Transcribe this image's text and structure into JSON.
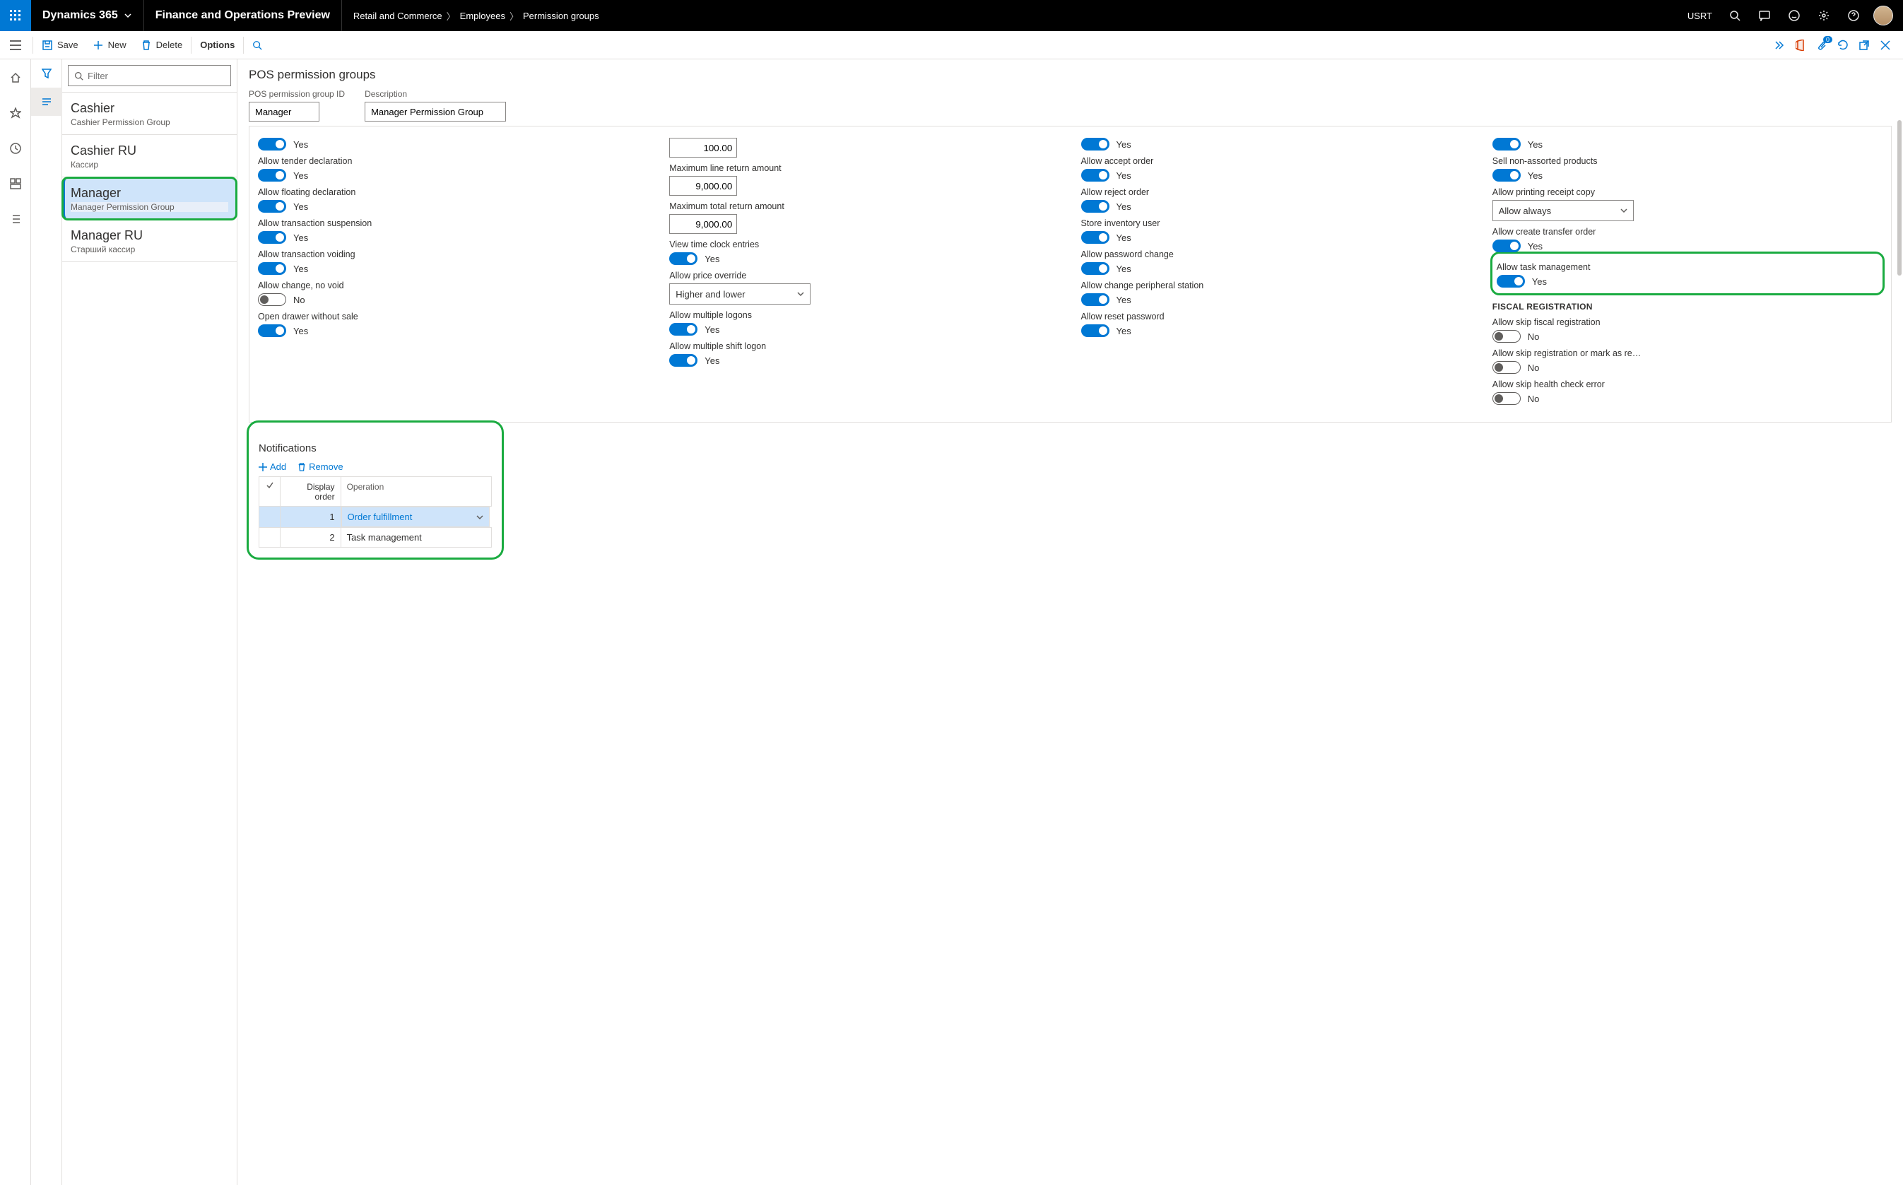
{
  "top": {
    "app": "Dynamics 365",
    "module": "Finance and Operations Preview",
    "crumbs": [
      "Retail and Commerce",
      "Employees",
      "Permission groups"
    ],
    "org": "USRT"
  },
  "toolbar": {
    "save": "Save",
    "new": "New",
    "delete": "Delete",
    "options": "Options",
    "badge": "0"
  },
  "filter_placeholder": "Filter",
  "list": [
    {
      "title": "Cashier",
      "sub": "Cashier Permission Group"
    },
    {
      "title": "Cashier RU",
      "sub": "Кассир"
    },
    {
      "title": "Manager",
      "sub": "Manager Permission Group"
    },
    {
      "title": "Manager RU",
      "sub": "Старший кассир"
    }
  ],
  "page": {
    "title": "POS permission groups",
    "id_label": "POS permission group ID",
    "id_value": "Manager",
    "desc_label": "Description",
    "desc_value": "Manager Permission Group"
  },
  "col1": [
    {
      "label": "",
      "val": "Yes",
      "on": true
    },
    {
      "label": "Allow tender declaration",
      "val": "Yes",
      "on": true
    },
    {
      "label": "Allow floating declaration",
      "val": "Yes",
      "on": true
    },
    {
      "label": "Allow transaction suspension",
      "val": "Yes",
      "on": true
    },
    {
      "label": "Allow transaction voiding",
      "val": "Yes",
      "on": true
    },
    {
      "label": "Allow change, no void",
      "val": "No",
      "on": false
    },
    {
      "label": "Open drawer without sale",
      "val": "Yes",
      "on": true
    }
  ],
  "col2_nums": [
    {
      "label": "",
      "val": "100.00"
    },
    {
      "label": "Maximum line return amount",
      "val": "9,000.00"
    },
    {
      "label": "Maximum total return amount",
      "val": "9,000.00"
    }
  ],
  "col2_tog": [
    {
      "label": "View time clock entries",
      "val": "Yes",
      "on": true
    }
  ],
  "col2_sel": {
    "label": "Allow price override",
    "val": "Higher and lower"
  },
  "col2_tog2": [
    {
      "label": "Allow multiple logons",
      "val": "Yes",
      "on": true
    },
    {
      "label": "Allow multiple shift logon",
      "val": "Yes",
      "on": true
    }
  ],
  "col3": [
    {
      "label": "",
      "val": "Yes",
      "on": true
    },
    {
      "label": "Allow accept order",
      "val": "Yes",
      "on": true
    },
    {
      "label": "Allow reject order",
      "val": "Yes",
      "on": true
    },
    {
      "label": "Store inventory user",
      "val": "Yes",
      "on": true
    },
    {
      "label": "Allow password change",
      "val": "Yes",
      "on": true
    },
    {
      "label": "Allow change peripheral station",
      "val": "Yes",
      "on": true
    },
    {
      "label": "Allow reset password",
      "val": "Yes",
      "on": true
    }
  ],
  "col4": [
    {
      "label": "",
      "val": "Yes",
      "on": true
    },
    {
      "label": "Sell non-assorted products",
      "val": "Yes",
      "on": true
    }
  ],
  "col4_sel": {
    "label": "Allow printing receipt copy",
    "val": "Allow always"
  },
  "col4b": [
    {
      "label": "Allow create transfer order",
      "val": "Yes",
      "on": true
    },
    {
      "label": "Allow task management",
      "val": "Yes",
      "on": true,
      "hl": true
    }
  ],
  "fiscal_h": "FISCAL REGISTRATION",
  "col4c": [
    {
      "label": "Allow skip fiscal registration",
      "val": "No",
      "on": false
    },
    {
      "label": "Allow skip registration or mark as re…",
      "val": "No",
      "on": false
    },
    {
      "label": "Allow skip health check error",
      "val": "No",
      "on": false
    }
  ],
  "notif": {
    "title": "Notifications",
    "add": "Add",
    "remove": "Remove",
    "headers": {
      "order": "Display order",
      "op": "Operation"
    },
    "rows": [
      {
        "order": "1",
        "op": "Order fulfillment",
        "sel": true
      },
      {
        "order": "2",
        "op": "Task management",
        "sel": false
      }
    ]
  }
}
